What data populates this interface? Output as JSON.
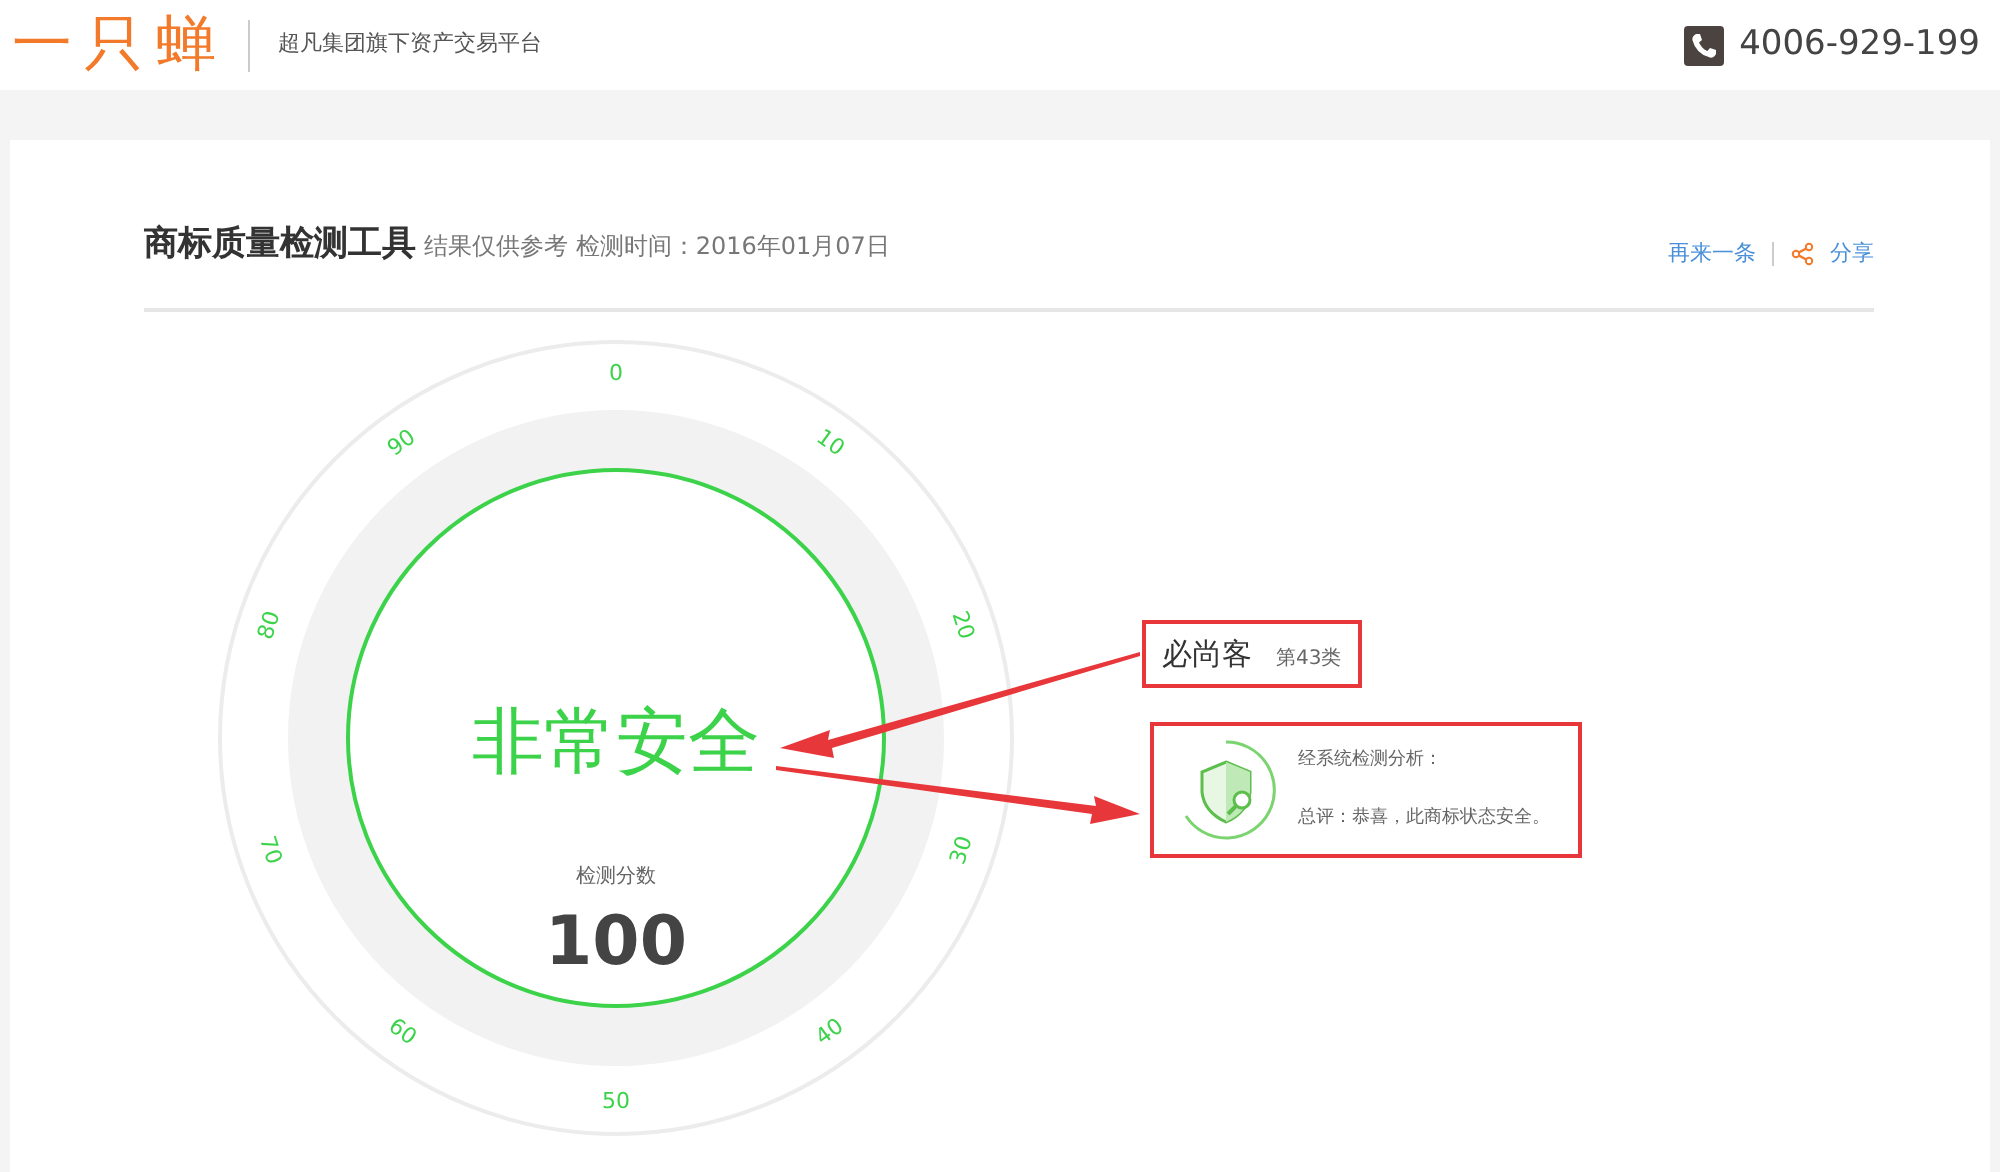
{
  "header": {
    "logo": "一只蝉",
    "tagline": "超凡集团旗下资产交易平台",
    "phone": "4006-929-199"
  },
  "report": {
    "title": "商标质量检测工具",
    "note": "结果仅供参考 检测时间：2016年01月07日",
    "actions": [
      {
        "kind": "link",
        "label": "再来一条"
      },
      {
        "kind": "share",
        "label": "分享"
      }
    ]
  },
  "gauge": {
    "ticks": [
      "0",
      "10",
      "20",
      "30",
      "40",
      "50",
      "60",
      "70",
      "80",
      "90"
    ],
    "level": 1,
    "verdict": "非常安全",
    "score_label": "检测分数",
    "score": "100"
  },
  "trademark": {
    "name": "必尚客",
    "class": "第43类"
  },
  "analysis": {
    "heading": "经系统检测分析：",
    "summary": "总评：恭喜，此商标状态安全。"
  }
}
